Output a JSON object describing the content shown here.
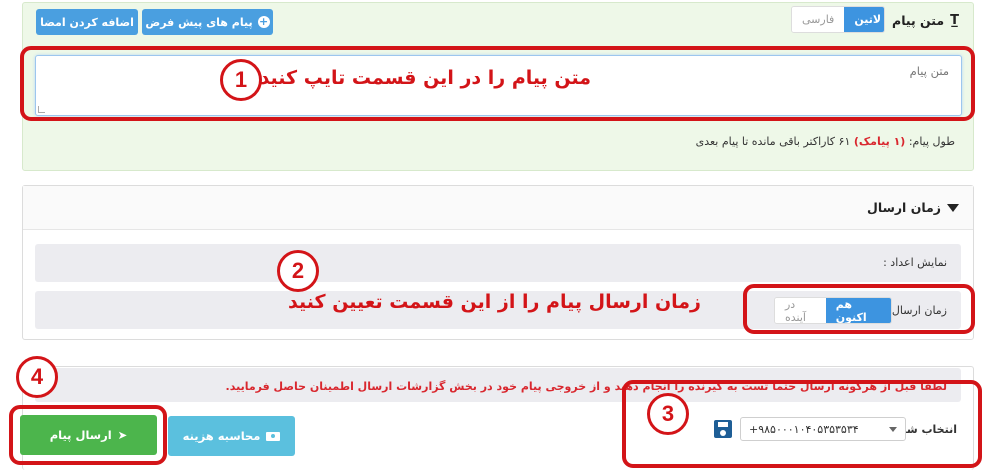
{
  "message_panel": {
    "title": "متن پیام",
    "default_messages_label": "پیام های پیش فرض",
    "add_signature_label": "اضافه کردن امضا",
    "textarea_placeholder": "متن پیام",
    "length_prefix": "طول پیام:",
    "length_count": "(۱ پیامک)",
    "length_suffix": "۶۱ کاراکتر باقی مانده تا پیام بعدی"
  },
  "schedule_panel": {
    "title": "زمان ارسال",
    "digits_label": "نمایش اعداد :",
    "digits_options": [
      "لاتین",
      "فارسی"
    ],
    "digits_selected": "لاتین",
    "send_time_label": "زمان ارسال :",
    "send_time_options": [
      "هم اکنون",
      "در آینده"
    ],
    "send_time_selected": "هم اکنون"
  },
  "send_panel": {
    "warning": "لطفا قبل از هرگونه ارسال حتما تست به گیرنده را انجام دهید و از خروجی پیام خود در بخش گزارشات ارسال اطمینان حاصل فرمایید.",
    "number_label": "انتخاب شماره :",
    "number_value": "+۹۸۵۰۰۰۱۰۴۰۵۳۵۳۵۳۴",
    "send_button": "ارسال پیام",
    "cost_button": "محاسبه هزینه"
  },
  "annotations": {
    "n1": "1",
    "n2": "2",
    "n3": "3",
    "n4": "4",
    "text1": "متن پیام را در این قسمت تایپ کنید",
    "text2": "زمان ارسال پیام را از این قسمت تعیین کنید"
  },
  "colors": {
    "annotation_red": "#d31418",
    "primary_blue": "#3d94e0",
    "send_green": "#4cb54c",
    "cost_cyan": "#5bc0de"
  }
}
